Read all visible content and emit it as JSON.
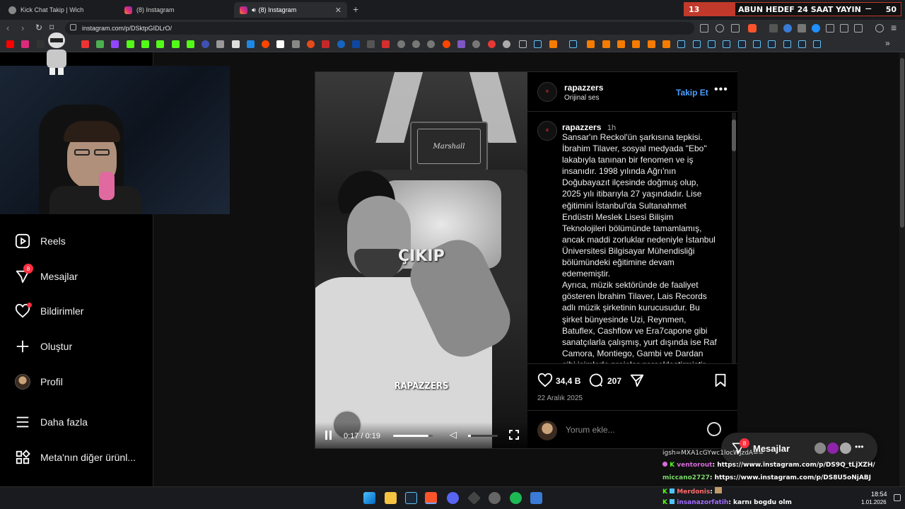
{
  "tabs": [
    {
      "title": "Kick Chat Takip | Wich",
      "active": false
    },
    {
      "title": "(8) Instagram",
      "active": false
    },
    {
      "title": "(8) Instagram",
      "active": true
    }
  ],
  "overlay_goal": {
    "left_number": "13",
    "text": "ABUN HEDEF 24 SAAT YAYIN",
    "right_number": "50"
  },
  "address_bar": {
    "url": "instagram.com/p/DSktpGIDLrO/"
  },
  "sidebar": {
    "items": [
      {
        "label": "Reels",
        "icon": "reels-icon"
      },
      {
        "label": "Mesajlar",
        "icon": "messenger-icon",
        "badge": "8"
      },
      {
        "label": "Bildirimler",
        "icon": "heart-icon"
      },
      {
        "label": "Oluştur",
        "icon": "plus-icon"
      },
      {
        "label": "Profil",
        "icon": "avatar"
      },
      {
        "label": "Daha fazla",
        "icon": "menu-icon"
      },
      {
        "label": "Meta'nın diğer ürünl...",
        "icon": "meta-apps-icon"
      }
    ]
  },
  "post": {
    "username": "rapazzers",
    "audio": "Orijinal ses",
    "follow_label": "Takip Et",
    "caption_user": "rapazzers",
    "caption_time": "1h",
    "caption_lines": [
      "Sansar'ın Reckol'ün şarkısına tepkisi.",
      "İbrahim Tilaver, sosyal medyada \"Ebo\"",
      "lakabıyla tanınan bir fenomen ve iş",
      "insanıdır. 1998 yılında Ağrı'nın",
      "Doğubayazıt ilçesinde doğmuş olup,",
      "2025 yılı itibarıyla 27 yaşındadır. Lise",
      "eğitimini İstanbul'da Sultanahmet",
      "Endüstri Meslek Lisesi Bilişim",
      "Teknolojileri bölümünde tamamlamış,",
      "ancak maddi zorluklar nedeniyle İstanbul",
      "Üniversitesi Bilgisayar Mühendisliği",
      "bölümündeki eğitimine devam",
      "edememiştir.",
      "Ayrıca, müzik sektöründe de faaliyet",
      "gösteren İbrahim Tilaver, Lais Records",
      "adlı müzik şirketinin kurucusudur. Bu",
      "şirket bünyesinde Uzi, Reynmen,",
      "Batuflex, Cashflow ve Era7capone gibi",
      "sanatçılarla çalışmış, yurt dışında ise Raf",
      "Camora, Montiego, Gambi ve Dardan",
      "gibi isimlerle projeler gerçekleştirmiştir."
    ],
    "likes": "34,4 B",
    "comments": "207",
    "date": "22 Aralık 2025",
    "comment_placeholder": "Yorum ekle...",
    "video": {
      "time": "0:17 / 0:19",
      "progress": 0.89,
      "watermark": "RAPAZZERS",
      "sign_text": "ÇIKIP",
      "amp_brand": "Marshall"
    }
  },
  "messages_popup": {
    "label": "Mesajlar",
    "badge": "8"
  },
  "chat_lines": [
    {
      "user": "",
      "text": "igsh=MXA1cGYwc1locWJzdA=="
    },
    {
      "user": "ventorout",
      "text": ": https://www.instagram.com/p/DS9Q_tLjXZH/",
      "user_color": "#d46bd6"
    },
    {
      "user": "miccano2727",
      "text": ": https://www.instagram.com/p/DS8U5oNjABJ",
      "user_color": "#7bd96b"
    },
    {
      "user": "Merdonis",
      "text": ":",
      "user_color": "#ff6b6b"
    },
    {
      "user": "insanazorfatih",
      "text": ": karnı bogdu olm",
      "user_color": "#a06bff"
    }
  ],
  "clock": {
    "time": "18:54",
    "date": "1.01.2026"
  },
  "colors": {
    "accent_blue": "#4a9eff",
    "notification_red": "#ff3040",
    "goal_red": "#c0392b"
  }
}
